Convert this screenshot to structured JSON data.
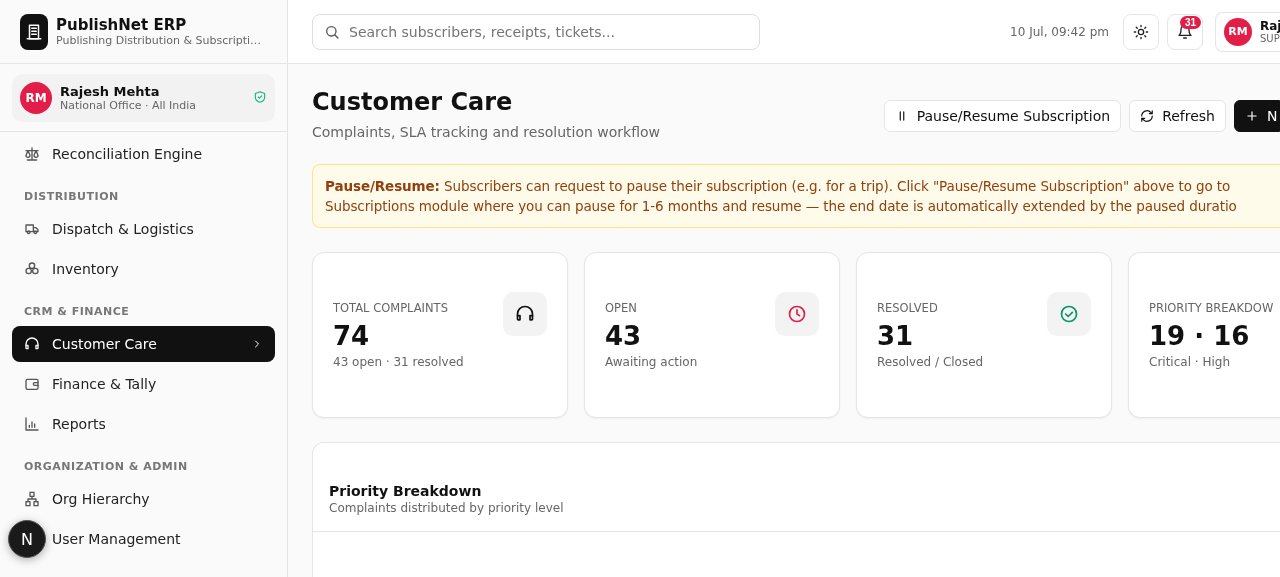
{
  "brand": {
    "name": "PublishNet ERP",
    "tagline": "Publishing Distribution & Subscripti…"
  },
  "user_card": {
    "initials": "RM",
    "name": "Rajesh Mehta",
    "office": "National Office · All India"
  },
  "nav": [
    {
      "kind": "item",
      "label": "Reconciliation Engine",
      "selected": false
    },
    {
      "kind": "section",
      "label": "DISTRIBUTION"
    },
    {
      "kind": "item",
      "label": "Dispatch & Logistics",
      "selected": false
    },
    {
      "kind": "item",
      "label": "Inventory",
      "selected": false
    },
    {
      "kind": "section",
      "label": "CRM & FINANCE"
    },
    {
      "kind": "item",
      "label": "Customer Care",
      "selected": true
    },
    {
      "kind": "item",
      "label": "Finance & Tally",
      "selected": false
    },
    {
      "kind": "item",
      "label": "Reports",
      "selected": false
    },
    {
      "kind": "section",
      "label": "ORGANIZATION & ADMIN"
    },
    {
      "kind": "item",
      "label": "Org Hierarchy",
      "selected": false
    },
    {
      "kind": "item",
      "label": "User Management",
      "selected": false
    }
  ],
  "dev_badge": "N",
  "topbar": {
    "search": {
      "placeholder": "Search subscribers, receipts, tickets..."
    },
    "datetime": "10 Jul, 09:42 pm",
    "notifications": "31",
    "user": {
      "initials": "RM",
      "name": "Raj",
      "role": "SUP"
    }
  },
  "page": {
    "title": "Customer Care",
    "subtitle": "Complaints, SLA tracking and resolution workflow"
  },
  "actions": [
    {
      "kind": "outline",
      "label": "Pause/Resume Subscription"
    },
    {
      "kind": "outline",
      "label": "Refresh"
    },
    {
      "kind": "primary",
      "label": "N"
    }
  ],
  "banner": "**Pause/Resume:** Subscribers can request to pause their subscription (e.g. for a trip). Click \"Pause/Resume Subscription\" above to go to Subscriptions module where you can pause for 1-6 months and resume — the end date is automatically extended by the paused duratio",
  "stats": [
    {
      "label": "TOTAL COMPLAINTS",
      "value": "74",
      "note": "43 open · 31 resolved",
      "color": "#111111"
    },
    {
      "label": "OPEN",
      "value": "43",
      "note": "Awaiting action",
      "color": "#e11d48"
    },
    {
      "label": "RESOLVED",
      "value": "31",
      "note": "Resolved / Closed",
      "color": "#059669"
    },
    {
      "label": "PRIORITY BREAKDOW",
      "value": "19 · 16",
      "note": "Critical · High"
    }
  ],
  "panel": {
    "title": "Priority Breakdown",
    "subtitle": "Complaints distributed by priority level"
  }
}
